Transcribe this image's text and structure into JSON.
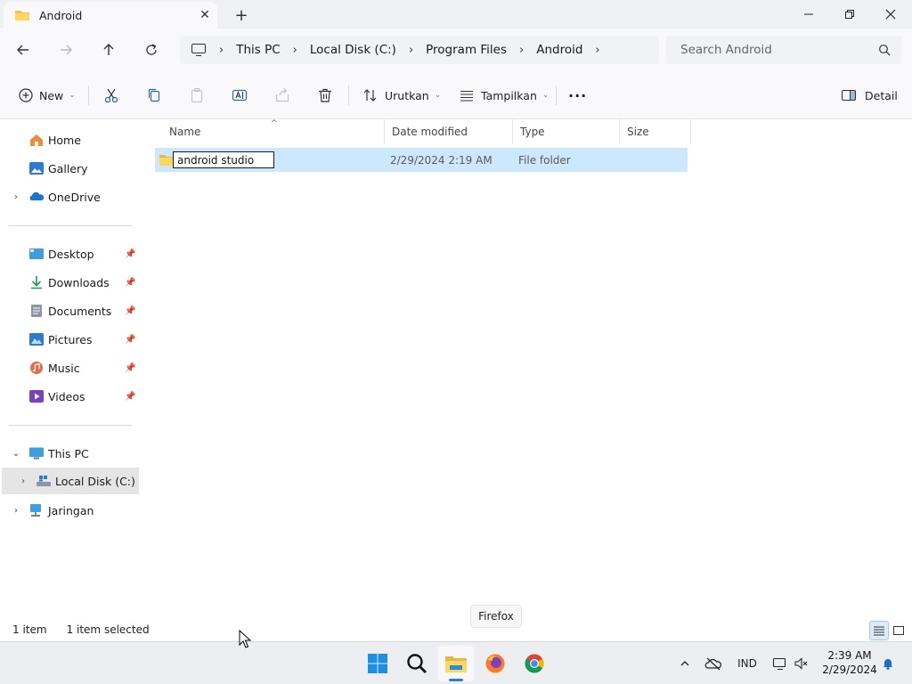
{
  "window": {
    "tab_title": "Android",
    "tab_close": "✕",
    "new_tab": "+"
  },
  "address": {
    "crumbs": [
      "This PC",
      "Local Disk (C:)",
      "Program Files",
      "Android"
    ],
    "separator": "›"
  },
  "search": {
    "placeholder": "Search Android"
  },
  "toolbar": {
    "new_label": "New",
    "sort_label": "Urutkan",
    "view_label": "Tampilkan",
    "more_label": "···",
    "details_label": "Detail"
  },
  "sidebar": {
    "quick": [
      {
        "label": "Home",
        "icon": "home-icon"
      },
      {
        "label": "Gallery",
        "icon": "gallery-icon"
      },
      {
        "label": "OneDrive",
        "icon": "onedrive-icon"
      }
    ],
    "pinned": [
      {
        "label": "Desktop",
        "icon": "desktop-icon"
      },
      {
        "label": "Downloads",
        "icon": "downloads-icon"
      },
      {
        "label": "Documents",
        "icon": "documents-icon"
      },
      {
        "label": "Pictures",
        "icon": "pictures-icon"
      },
      {
        "label": "Music",
        "icon": "music-icon"
      },
      {
        "label": "Videos",
        "icon": "videos-icon"
      }
    ],
    "devices": [
      {
        "label": "This PC",
        "icon": "this-pc-icon"
      },
      {
        "label": "Local Disk (C:)",
        "icon": "drive-icon"
      },
      {
        "label": "Jaringan",
        "icon": "network-icon"
      }
    ]
  },
  "columns": [
    "Name",
    "Date modified",
    "Type",
    "Size"
  ],
  "rows": [
    {
      "name": "android studio",
      "date": "2/29/2024 2:19 AM",
      "type": "File folder",
      "size": ""
    }
  ],
  "status": {
    "count": "1 item",
    "selected": "1 item selected"
  },
  "tooltip": "Firefox",
  "taskbar": {
    "language": "IND",
    "time": "2:39 AM",
    "date": "2/29/2024"
  },
  "colors": {
    "selection": "#cce8ff",
    "accent": "#0067c0",
    "folder": "#f5c542"
  }
}
